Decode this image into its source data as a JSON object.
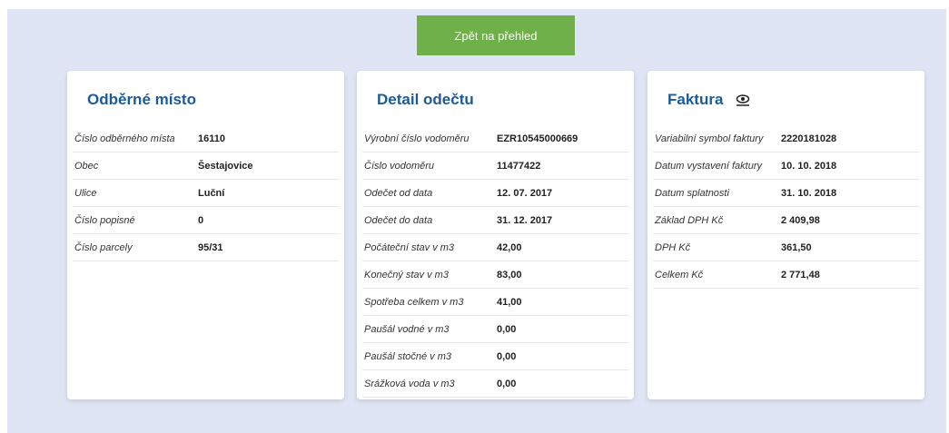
{
  "back_button": {
    "label": "Zpět na přehled"
  },
  "cards": [
    {
      "title": "Odběrné místo",
      "rows": [
        {
          "label": "Číslo odběrného místa",
          "value": "16110"
        },
        {
          "label": "Obec",
          "value": "Šestajovice"
        },
        {
          "label": "Ulice",
          "value": "Luční"
        },
        {
          "label": "Číslo popisné",
          "value": "0"
        },
        {
          "label": "Číslo parcely",
          "value": "95/31"
        }
      ]
    },
    {
      "title": "Detail odečtu",
      "rows": [
        {
          "label": "Výrobní číslo vodoměru",
          "value": "EZR10545000669"
        },
        {
          "label": "Číslo vodoměru",
          "value": "11477422"
        },
        {
          "label": "Odečet od data",
          "value": "12. 07. 2017"
        },
        {
          "label": "Odečet do data",
          "value": "31. 12. 2017"
        },
        {
          "label": "Počáteční stav v m3",
          "value": "42,00"
        },
        {
          "label": "Konečný stav v m3",
          "value": "83,00"
        },
        {
          "label": "Spotřeba celkem v m3",
          "value": "41,00"
        },
        {
          "label": "Paušál vodné v m3",
          "value": "0,00"
        },
        {
          "label": "Paušál stočné v m3",
          "value": "0,00"
        },
        {
          "label": "Srážková voda v m3",
          "value": "0,00"
        }
      ]
    },
    {
      "title": "Faktura",
      "icon": "eye-icon",
      "rows": [
        {
          "label": "Variabilní symbol faktury",
          "value": "2220181028"
        },
        {
          "label": "Datum vystavení faktury",
          "value": "10. 10. 2018"
        },
        {
          "label": "Datum splatnosti",
          "value": "31. 10. 2018"
        },
        {
          "label": "Základ DPH Kč",
          "value": "2 409,98"
        },
        {
          "label": "DPH Kč",
          "value": "361,50"
        },
        {
          "label": "Celkem Kč",
          "value": "2 771,48"
        }
      ]
    }
  ],
  "colors": {
    "accent": "#1c5a9a",
    "button": "#6fb04a",
    "background": "#dfe5f4"
  }
}
